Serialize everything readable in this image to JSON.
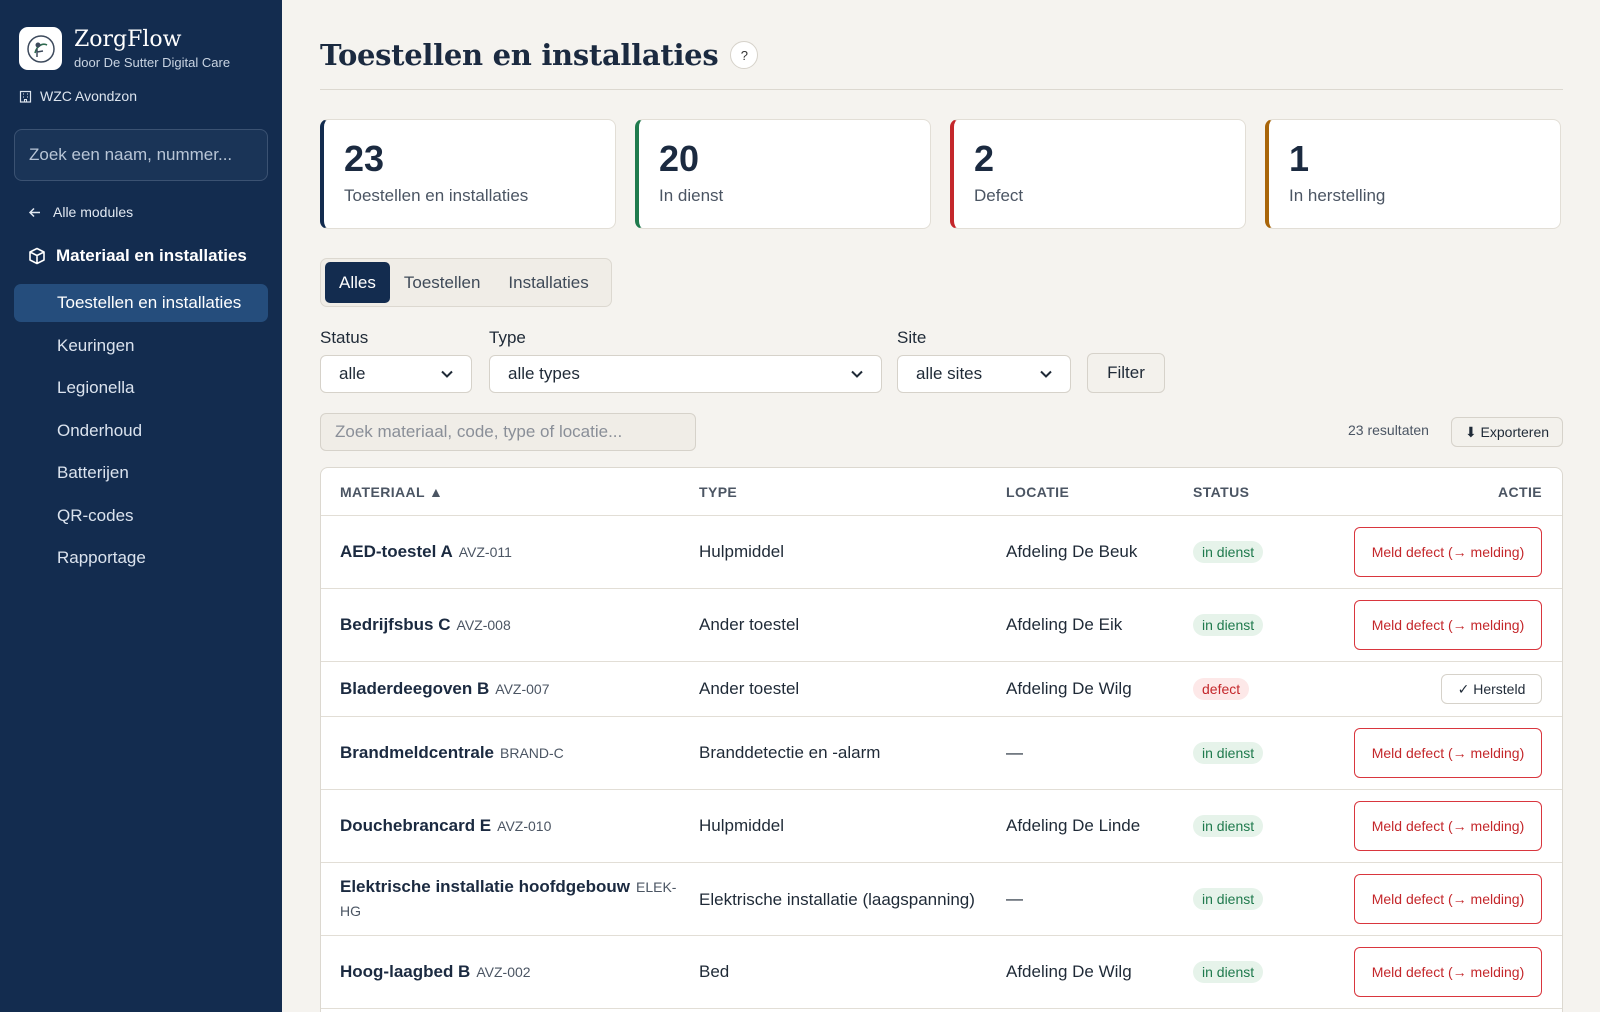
{
  "brand": {
    "name": "ZorgFlow",
    "subtitle": "door De Sutter Digital Care",
    "facility": "WZC Avondzon"
  },
  "sidebar": {
    "search_placeholder": "Zoek een naam, nummer...",
    "back_label": "Alle modules",
    "module_title": "Materiaal en installaties",
    "items": [
      {
        "label": "Toestellen en installaties",
        "active": true
      },
      {
        "label": "Keuringen"
      },
      {
        "label": "Legionella"
      },
      {
        "label": "Onderhoud"
      },
      {
        "label": "Batterijen"
      },
      {
        "label": "QR-codes"
      },
      {
        "label": "Rapportage"
      }
    ]
  },
  "page": {
    "title": "Toestellen en installaties",
    "help": "?"
  },
  "stats": [
    {
      "value": "23",
      "label": "Toestellen en installaties",
      "color": "#132c4f"
    },
    {
      "value": "20",
      "label": "In dienst",
      "color": "#1f7a4d"
    },
    {
      "value": "2",
      "label": "Defect",
      "color": "#c4272b"
    },
    {
      "value": "1",
      "label": "In herstelling",
      "color": "#a8650a"
    }
  ],
  "tabs": {
    "all": "Alles",
    "devices": "Toestellen",
    "installations": "Installaties"
  },
  "filters": {
    "status_label": "Status",
    "status_value": "alle",
    "type_label": "Type",
    "type_value": "alle types",
    "site_label": "Site",
    "site_value": "alle sites",
    "button": "Filter"
  },
  "list": {
    "search_placeholder": "Zoek materiaal, code, type of locatie...",
    "results": "23 resultaten",
    "export": "⬇ Exporteren"
  },
  "table": {
    "headers": {
      "material": "MATERIAAL ▲",
      "type": "TYPE",
      "location": "LOCATIE",
      "status": "STATUS",
      "action": "ACTIE"
    },
    "defect_label": "Meld defect (→ melding)",
    "fixed_label": "✓ Hersteld",
    "rows": [
      {
        "name": "AED-toestel A",
        "code": "AVZ-011",
        "type": "Hulpmiddel",
        "location": "Afdeling De Beuk",
        "status": "in dienst"
      },
      {
        "name": "Bedrijfsbus C",
        "code": "AVZ-008",
        "type": "Ander toestel",
        "location": "Afdeling De Eik",
        "status": "in dienst"
      },
      {
        "name": "Bladerdeegoven B",
        "code": "AVZ-007",
        "type": "Ander toestel",
        "location": "Afdeling De Wilg",
        "status": "defect"
      },
      {
        "name": "Brandmeldcentrale",
        "code": "BRAND-C",
        "type": "Branddetectie en -alarm",
        "location": "—",
        "status": "in dienst"
      },
      {
        "name": "Douchebrancard E",
        "code": "AVZ-010",
        "type": "Hulpmiddel",
        "location": "Afdeling De Linde",
        "status": "in dienst"
      },
      {
        "name": "Elektrische installatie hoofdgebouw",
        "code": "ELEK-HG",
        "type": "Elektrische installatie (laagspanning)",
        "location": "—",
        "status": "in dienst"
      },
      {
        "name": "Hoog-laagbed B",
        "code": "AVZ-002",
        "type": "Bed",
        "location": "Afdeling De Wilg",
        "status": "in dienst"
      }
    ]
  }
}
